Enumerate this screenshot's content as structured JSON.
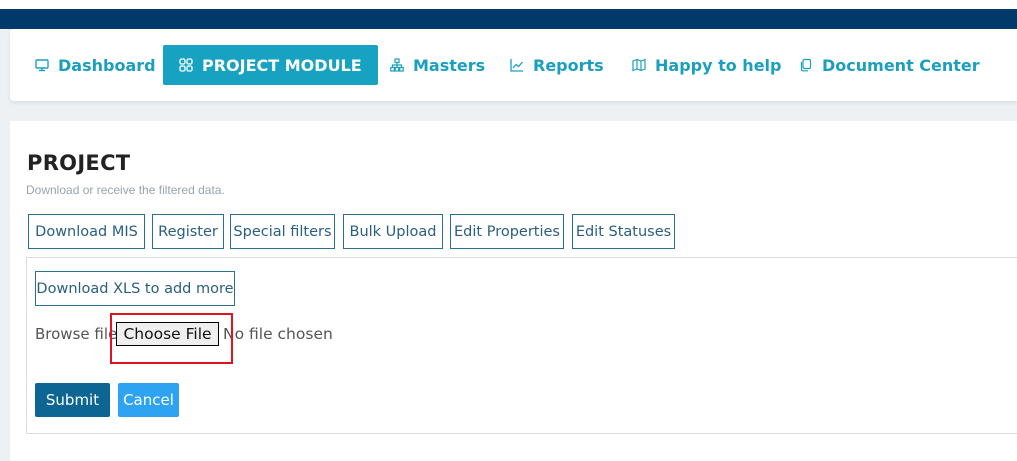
{
  "nav": {
    "items": [
      {
        "label": "Dashboard",
        "icon": "monitor-icon"
      },
      {
        "label": "PROJECT MODULE",
        "icon": "grid-icon",
        "active": true
      },
      {
        "label": "Masters",
        "icon": "sitemap-icon"
      },
      {
        "label": "Reports",
        "icon": "line-chart-icon"
      },
      {
        "label": "Happy to help",
        "icon": "map-icon"
      },
      {
        "label": "Document Center",
        "icon": "copy-icon"
      }
    ]
  },
  "page": {
    "title": "PROJECT",
    "subtitle": "Download or receive the filtered data."
  },
  "tabs": [
    {
      "label": "Download MIS"
    },
    {
      "label": "Register"
    },
    {
      "label": "Special filters"
    },
    {
      "label": "Bulk Upload"
    },
    {
      "label": "Edit Properties"
    },
    {
      "label": "Edit Statuses"
    }
  ],
  "upload": {
    "download_xls_label": "Download XLS to add more",
    "browse_label": "Browse file",
    "choose_file_label": "Choose File",
    "file_status": "No file chosen",
    "submit_label": "Submit",
    "cancel_label": "Cancel"
  },
  "colors": {
    "header": "#003a6b",
    "accent": "#17a2c2",
    "submit": "#0d6593",
    "cancel": "#2ea3f2",
    "highlight": "#e0141e"
  }
}
